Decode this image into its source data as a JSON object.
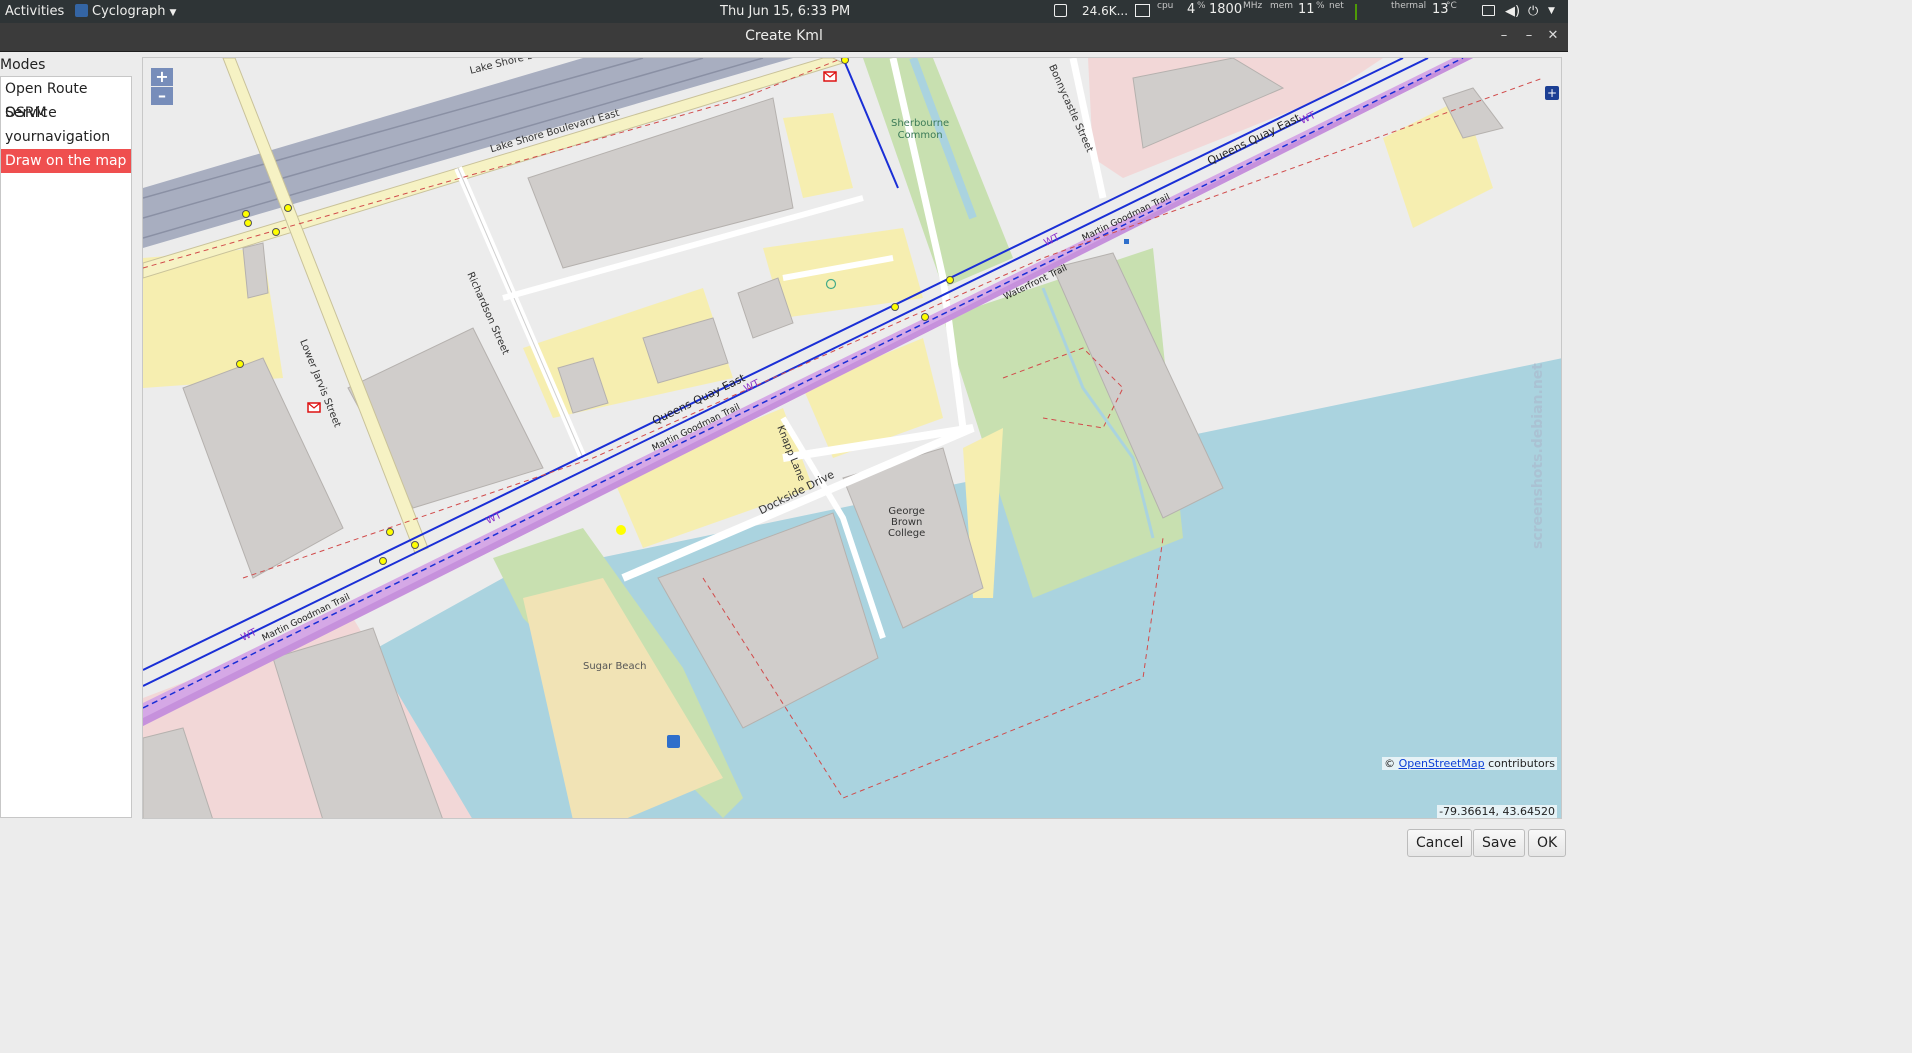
{
  "topbar": {
    "activities": "Activities",
    "app_menu": "Cyclograph",
    "clock": "Thu Jun 15,  6:33 PM",
    "net_speed": "24.6K...",
    "cpu_label": "cpu",
    "cpu_value": "4",
    "cpu_unit": "%",
    "freq_value": "1800",
    "freq_unit": "MHz",
    "mem_label": "mem",
    "mem_value": "11",
    "mem_unit": "%",
    "net_label": "net",
    "thermal_label": "thermal",
    "thermal_value": "13",
    "thermal_unit": "°C"
  },
  "window": {
    "title": "Create Kml",
    "minimize": "–",
    "maximize": "–",
    "close": "✕"
  },
  "sidebar": {
    "label": "Modes",
    "items": [
      {
        "label": "Open Route Service"
      },
      {
        "label": "OSRM"
      },
      {
        "label": "yournavigation"
      },
      {
        "label": "Draw on the map"
      }
    ],
    "selected": "Draw on the map"
  },
  "map": {
    "zoom_in": "+",
    "zoom_out": "–",
    "labels": {
      "lake_shore_top": "Lake Shore B",
      "lake_shore_blvd": "Lake Shore Boulevard East",
      "richardson": "Richardson Street",
      "lower_jarvis": "Lower Jarvis Street",
      "queens_quay_w": "Queens Quay East",
      "queens_quay_e": "Queens Quay East",
      "martin_goodman_w": "Martin Goodman Trail",
      "martin_goodman_c": "Martin Goodman Trail",
      "martin_goodman_e": "Martin Goodman Trail",
      "waterfront_trail": "Waterfront Trail",
      "knapp_lane": "Knapp Lane",
      "dockside": "Dockside Drive",
      "bonnycastle": "Bonnycastle Street",
      "sherbourne": "Sherbourne\nCommon",
      "george_brown": "George\nBrown\nCollege",
      "sugar_beach": "Sugar Beach",
      "wt": "WT"
    },
    "attribution_prefix": "©",
    "attribution_link": "OpenStreetMap",
    "attribution_suffix": "contributors",
    "coordinates": "-79.36614, 43.64520",
    "watermark": "screenshots.debian.net",
    "colors": {
      "water": "#aad3df",
      "park": "#c8e0b0",
      "building": "#d0cdcb",
      "parking": "#f6eeb0",
      "commercial": "#f2d7d7",
      "trail": "#d5a8e6",
      "road_blue": "#1a2fd6",
      "motorway": "#a8aec0"
    }
  },
  "buttons": {
    "cancel": "Cancel",
    "save": "Save",
    "ok": "OK"
  }
}
